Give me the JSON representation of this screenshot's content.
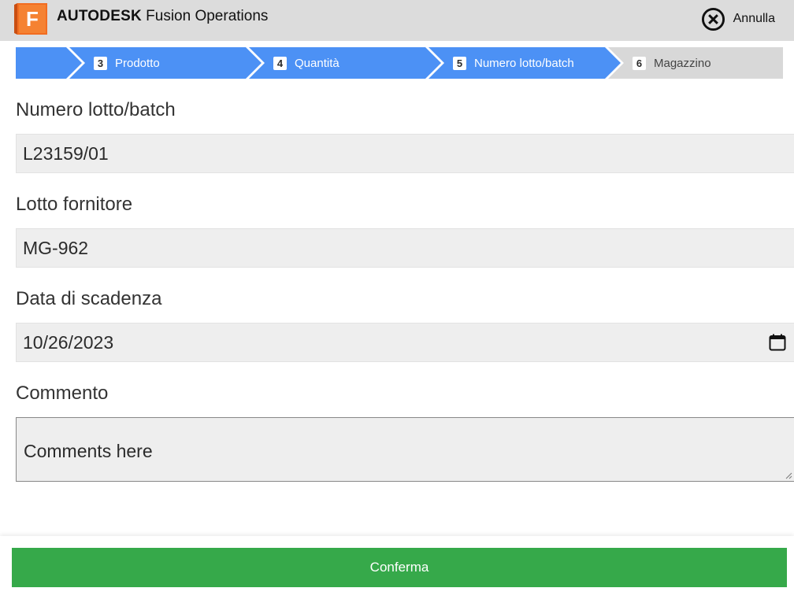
{
  "header": {
    "logo_letter": "F",
    "brand_bold": "AUTODESK",
    "brand_product": "Fusion Operations",
    "cancel_label": "Annulla"
  },
  "stepper": {
    "steps": [
      {
        "number": "3",
        "label": "Prodotto",
        "state": "done"
      },
      {
        "number": "4",
        "label": "Quantità",
        "state": "done"
      },
      {
        "number": "5",
        "label": "Numero lotto/batch",
        "state": "current"
      },
      {
        "number": "6",
        "label": "Magazzino",
        "state": "todo"
      }
    ],
    "done_color": "#4c91f5",
    "todo_color": "#d8d8d8"
  },
  "form": {
    "lot_label": "Numero lotto/batch",
    "lot_value": "L23159/01",
    "supplier_lot_label": "Lotto fornitore",
    "supplier_lot_value": "MG-962",
    "expiry_label": "Data di scadenza",
    "expiry_value": "10/26/2023",
    "comment_label": "Commento",
    "comment_placeholder": "Comments here"
  },
  "footer": {
    "confirm_label": "Conferma",
    "confirm_color": "#36a94a"
  },
  "icons": {
    "logo": "autodesk-fusion-logo-icon",
    "cancel": "close-circle-icon",
    "calendar": "calendar-icon"
  }
}
